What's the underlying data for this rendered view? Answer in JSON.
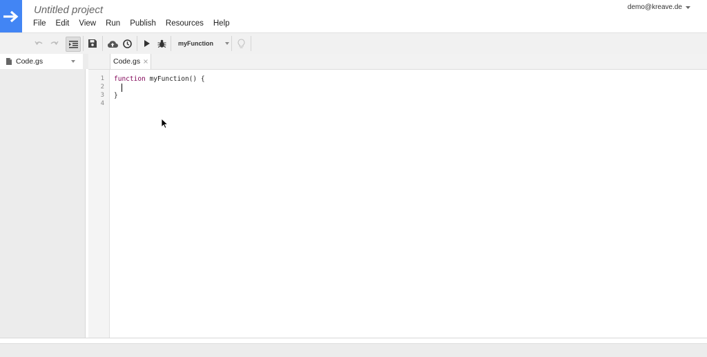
{
  "header": {
    "project_title": "Untitled project",
    "account_email": "demo@kreave.de"
  },
  "menubar": {
    "items": [
      "File",
      "Edit",
      "View",
      "Run",
      "Publish",
      "Resources",
      "Help"
    ]
  },
  "toolbar": {
    "selected_function": "myFunction"
  },
  "files": {
    "items": [
      "Code.gs"
    ]
  },
  "tabs": {
    "items": [
      "Code.gs"
    ]
  },
  "editor": {
    "line_numbers": [
      "1",
      "2",
      "3",
      "4"
    ],
    "keyword": "function",
    "line1_rest": " myFunction() {",
    "line3": "}"
  },
  "colors": {
    "brand": "#4285f4",
    "toolbar_bg": "#f1f1f1",
    "panel_bg": "#ececec",
    "keyword": "#7f0055"
  }
}
